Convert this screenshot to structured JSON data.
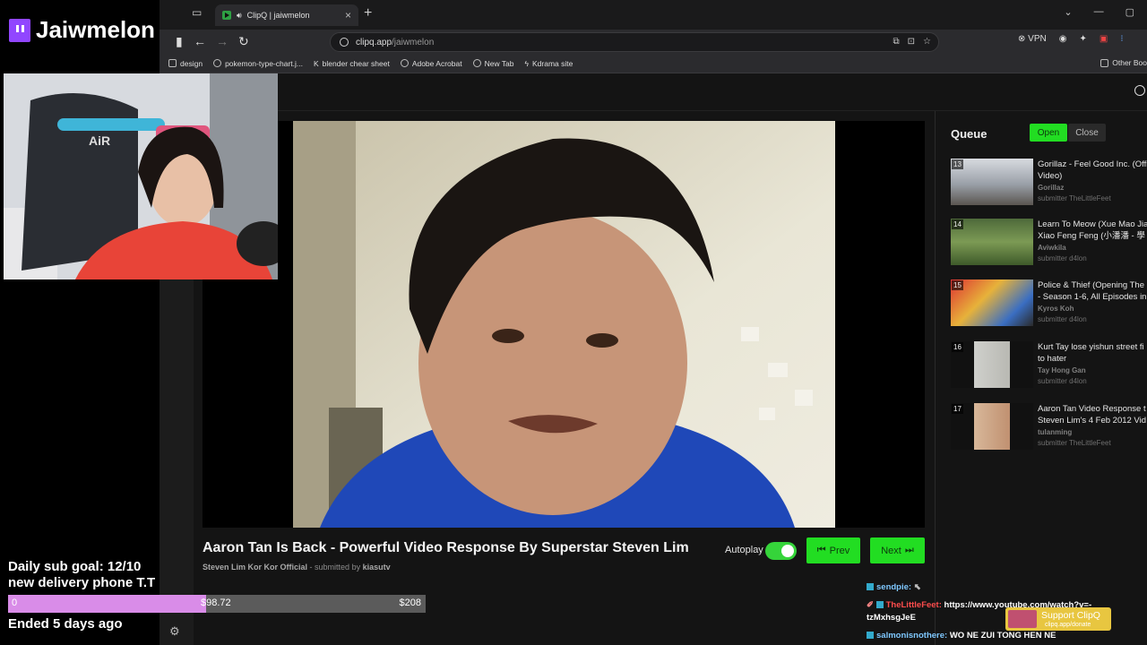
{
  "stream": {
    "channel_name": "Jaiwmelon",
    "goal_line1": "Daily sub goal: 12/10",
    "goal_line2": "new delivery phone T.T",
    "goal_start": "0",
    "goal_current": "$98.72",
    "goal_target": "$208",
    "goal_progress": 0.475,
    "ended": "Ended 5 days ago"
  },
  "browser": {
    "tab_title": "ClipQ | jaiwmelon",
    "url_host": "clipq.app",
    "url_path": "/jaiwmelon",
    "vpn_label": "VPN",
    "other_bookmarks": "Other Boo",
    "bookmarks": [
      "design",
      "pokemon-type-chart.j...",
      "blender chear sheet",
      "Adobe Acrobat",
      "New Tab",
      "Kdrama site"
    ]
  },
  "video": {
    "title": "Aaron Tan Is Back - Powerful Video Response By Superstar Steven Lim",
    "channel": "Steven Lim Kor Kor Official",
    "submitted_prefix": "- submitted by",
    "submitter": "kiasutv",
    "autoplay_label": "Autoplay",
    "autoplay_on": true,
    "prev_label": "Prev",
    "next_label": "Next"
  },
  "queue": {
    "title": "Queue",
    "open_label": "Open",
    "close_label": "Close",
    "items": [
      {
        "num": "13",
        "title": "Gorillaz - Feel Good Inc. (Offi",
        "title2": "Video)",
        "channel": "Gorillaz",
        "submitter": "submitter TheLittleFeet"
      },
      {
        "num": "14",
        "title": "Learn To Meow (Xue Mao Jia",
        "title2": "Xiao Feng Feng (小潘潘 - 學",
        "channel": "Aviwkila",
        "submitter": "submitter d4lon"
      },
      {
        "num": "15",
        "title": "Police & Thief (Opening The",
        "title2": "- Season 1-6, All Episodes in",
        "channel": "Kyros Koh",
        "submitter": "submitter d4lon"
      },
      {
        "num": "16",
        "title": "Kurt Tay lose yishun street fi",
        "title2": "to hater",
        "channel": "Tay Hong Gan",
        "submitter": "submitter d4lon"
      },
      {
        "num": "17",
        "title": "Aaron Tan Video Response t",
        "title2": "Steven Lim's 4 Feb 2012 Vid",
        "channel": "tulanming",
        "submitter": "submitter TheLittleFeet"
      }
    ]
  },
  "chat": [
    {
      "user": "sendpie:",
      "user_color": "#7fc8ff",
      "text": ""
    },
    {
      "user": "TheLittleFeet:",
      "user_color": "#ff4d4d",
      "text": "https://www.youtube.com/watch?v=-",
      "text2": "tzMxhsgJeE"
    },
    {
      "user": "salmonisnothere:",
      "user_color": "#7fc8ff",
      "text": "WO NE ZUI TONG HEN NE"
    }
  ],
  "support": {
    "label": "Support ClipQ",
    "sub": "clipq.app/donate"
  }
}
